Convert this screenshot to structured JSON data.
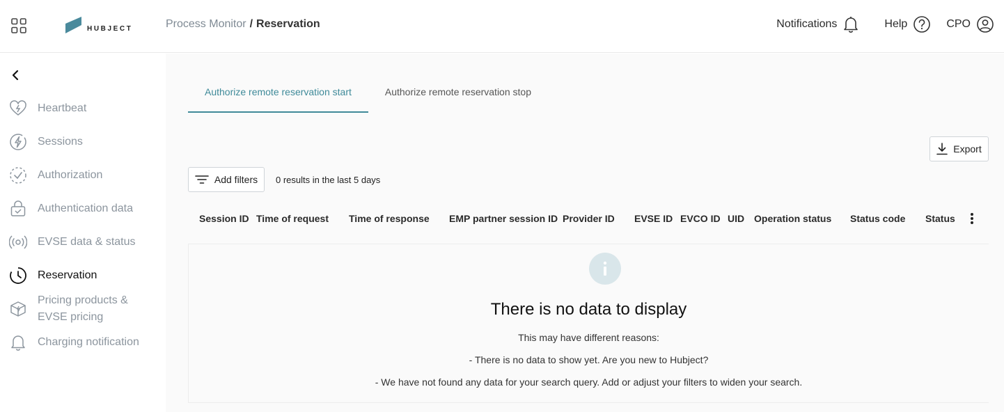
{
  "header": {
    "logo_text": "HUBJECT",
    "breadcrumb": {
      "parent": "Process Monitor",
      "separator": "/",
      "current": "Reservation"
    },
    "notifications_label": "Notifications",
    "help_label": "Help",
    "user_label": "CPO"
  },
  "sidebar": {
    "items": [
      {
        "label": "Heartbeat",
        "icon": "heart-bolt-icon"
      },
      {
        "label": "Sessions",
        "icon": "bolt-circle-icon"
      },
      {
        "label": "Authorization",
        "icon": "check-circle-icon"
      },
      {
        "label": "Authentication data",
        "icon": "lock-check-icon"
      },
      {
        "label": "EVSE data & status",
        "icon": "broadcast-icon"
      },
      {
        "label": "Reservation",
        "icon": "clock-icon"
      },
      {
        "label": "Pricing products &",
        "label2": "EVSE pricing",
        "icon": "box-icon"
      },
      {
        "label": "Charging notification",
        "icon": "bell-icon"
      }
    ],
    "active_index": 5
  },
  "main": {
    "tabs": [
      {
        "label": "Authorize remote reservation start",
        "active": true
      },
      {
        "label": "Authorize remote reservation stop",
        "active": false
      }
    ],
    "export_label": "Export",
    "add_filters_label": "Add filters",
    "results_text": "0 results in the last 5 days",
    "columns": [
      "Session ID",
      "Time of request",
      "Time of response",
      "EMP partner session ID",
      "Provider ID",
      "EVSE ID",
      "EVCO ID",
      "UID",
      "Operation status",
      "Status code",
      "Status"
    ],
    "empty": {
      "title": "There is no data to display",
      "line1": "This may have different reasons:",
      "line2": "- There is no data to show yet. Are you new to Hubject?",
      "line3": "- We have not found any data for your search query. Add or adjust your filters to widen your search."
    }
  },
  "colors": {
    "accent": "#3f8a99",
    "logo": "#4a8a9c",
    "muted_text": "#8c959e"
  }
}
